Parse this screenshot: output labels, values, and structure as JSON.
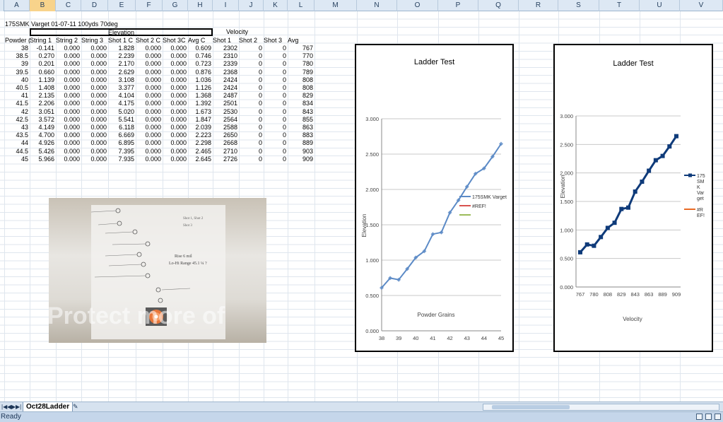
{
  "columns": [
    "A",
    "B",
    "C",
    "D",
    "E",
    "F",
    "G",
    "H",
    "I",
    "J",
    "K",
    "L",
    "M",
    "N",
    "O",
    "P",
    "Q",
    "R",
    "S",
    "T",
    "U",
    "V"
  ],
  "selected_column": "B",
  "sheet_title": "175SMK Varget 01-07-11 100yds 70deg",
  "group_headers": {
    "elevation": "Elevation",
    "velocity": "Velocity"
  },
  "table_headers": [
    "Powder (",
    "String 1",
    "String 2",
    "String 3",
    "Shot 1 C",
    "Shot 2 C",
    "Shot 3C",
    "Avg C",
    "Shot 1",
    "Shot 2",
    "Shot 3",
    "Avg"
  ],
  "rows": [
    [
      "38",
      "-0.141",
      "0.000",
      "0.000",
      "1.828",
      "0.000",
      "0.000",
      "0.609",
      "2302",
      "0",
      "0",
      "767"
    ],
    [
      "38.5",
      "0.270",
      "0.000",
      "0.000",
      "2.239",
      "0.000",
      "0.000",
      "0.746",
      "2310",
      "0",
      "0",
      "770"
    ],
    [
      "39",
      "0.201",
      "0.000",
      "0.000",
      "2.170",
      "0.000",
      "0.000",
      "0.723",
      "2339",
      "0",
      "0",
      "780"
    ],
    [
      "39.5",
      "0.660",
      "0.000",
      "0.000",
      "2.629",
      "0.000",
      "0.000",
      "0.876",
      "2368",
      "0",
      "0",
      "789"
    ],
    [
      "40",
      "1.139",
      "0.000",
      "0.000",
      "3.108",
      "0.000",
      "0.000",
      "1.036",
      "2424",
      "0",
      "0",
      "808"
    ],
    [
      "40.5",
      "1.408",
      "0.000",
      "0.000",
      "3.377",
      "0.000",
      "0.000",
      "1.126",
      "2424",
      "0",
      "0",
      "808"
    ],
    [
      "41",
      "2.135",
      "0.000",
      "0.000",
      "4.104",
      "0.000",
      "0.000",
      "1.368",
      "2487",
      "0",
      "0",
      "829"
    ],
    [
      "41.5",
      "2.206",
      "0.000",
      "0.000",
      "4.175",
      "0.000",
      "0.000",
      "1.392",
      "2501",
      "0",
      "0",
      "834"
    ],
    [
      "42",
      "3.051",
      "0.000",
      "0.000",
      "5.020",
      "0.000",
      "0.000",
      "1.673",
      "2530",
      "0",
      "0",
      "843"
    ],
    [
      "42.5",
      "3.572",
      "0.000",
      "0.000",
      "5.541",
      "0.000",
      "0.000",
      "1.847",
      "2564",
      "0",
      "0",
      "855"
    ],
    [
      "43",
      "4.149",
      "0.000",
      "0.000",
      "6.118",
      "0.000",
      "0.000",
      "2.039",
      "2588",
      "0",
      "0",
      "863"
    ],
    [
      "43.5",
      "4.700",
      "0.000",
      "0.000",
      "6.669",
      "0.000",
      "0.000",
      "2.223",
      "2650",
      "0",
      "0",
      "883"
    ],
    [
      "44",
      "4.926",
      "0.000",
      "0.000",
      "6.895",
      "0.000",
      "0.000",
      "2.298",
      "2668",
      "0",
      "0",
      "889"
    ],
    [
      "44.5",
      "5.426",
      "0.000",
      "0.000",
      "7.395",
      "0.000",
      "0.000",
      "2.465",
      "2710",
      "0",
      "0",
      "903"
    ],
    [
      "45",
      "5.966",
      "0.000",
      "0.000",
      "7.935",
      "0.000",
      "0.000",
      "2.645",
      "2726",
      "0",
      "0",
      "909"
    ]
  ],
  "photo": {
    "watermark": "Protect more of",
    "notes": [
      "Rise 6 mil",
      "Lo-Hi Range 45.1 ¼ ?",
      "Shot 1, Shot 2",
      "Shot 3"
    ]
  },
  "chart_data": [
    {
      "type": "line",
      "title": "Ladder Test",
      "xlabel": "Powder Grains",
      "ylabel": "Elevation",
      "x": [
        38,
        38.5,
        39,
        39.5,
        40,
        40.5,
        41,
        41.5,
        42,
        42.5,
        43,
        43.5,
        44,
        44.5,
        45
      ],
      "x_tick_labels": [
        "38",
        "39",
        "40",
        "41",
        "42",
        "43",
        "44",
        "45"
      ],
      "ylim": [
        0,
        3
      ],
      "y_tick_labels": [
        "0.000",
        "0.500",
        "1.000",
        "1.500",
        "2.000",
        "2.500",
        "3.000"
      ],
      "series": [
        {
          "name": "175SMK Varget",
          "values": [
            0.609,
            0.746,
            0.723,
            0.876,
            1.036,
            1.126,
            1.368,
            1.392,
            1.673,
            1.847,
            2.039,
            2.223,
            2.298,
            2.465,
            2.645
          ],
          "color": "#5b8ac6"
        },
        {
          "name": "#REF!",
          "values": [],
          "color": "#d9534f"
        },
        {
          "name": "",
          "values": [],
          "color": "#9bbb59"
        }
      ],
      "grid": true,
      "legend": "right"
    },
    {
      "type": "line",
      "title": "Ladder Test",
      "xlabel": "Velocity",
      "ylabel": "Elevation",
      "x_tick_labels": [
        "767",
        "780",
        "808",
        "829",
        "843",
        "863",
        "889",
        "909"
      ],
      "categories": [
        "767",
        "770",
        "780",
        "789",
        "808",
        "808",
        "829",
        "834",
        "843",
        "855",
        "863",
        "883",
        "889",
        "903",
        "909"
      ],
      "ylim": [
        0,
        3
      ],
      "y_tick_labels": [
        "0.000",
        "0.500",
        "1.000",
        "1.500",
        "2.000",
        "2.500",
        "3.000"
      ],
      "series": [
        {
          "name": "175 SM K Var get",
          "values": [
            0.609,
            0.746,
            0.723,
            0.876,
            1.036,
            1.126,
            1.368,
            1.392,
            1.673,
            1.847,
            2.039,
            2.223,
            2.298,
            2.465,
            2.645
          ],
          "color": "#0f3b7a"
        },
        {
          "name": "#R EF!",
          "values": [],
          "color": "#e86a25"
        }
      ],
      "grid": true,
      "legend": "right"
    }
  ],
  "sheet_tab": "Oct28Ladder",
  "status": "Ready"
}
